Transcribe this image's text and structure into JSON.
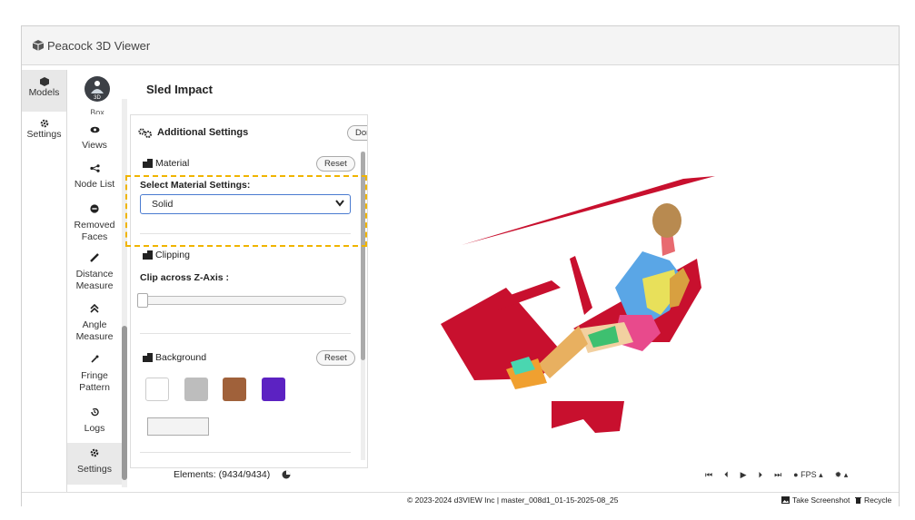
{
  "app": {
    "title": "Peacock 3D Viewer"
  },
  "left_nav": [
    {
      "label": "Models",
      "icon": "cube-icon"
    },
    {
      "label": "Settings",
      "icon": "gear-icon"
    }
  ],
  "tools": {
    "top_cut": "Box",
    "badge": "3D",
    "items": [
      {
        "label": "Views",
        "icon": "eye-icon"
      },
      {
        "label": "Node List",
        "icon": "share-nodes-icon"
      },
      {
        "label": "Removed\nFaces",
        "icon": "minus-circle-icon"
      },
      {
        "label": "Distance\nMeasure",
        "icon": "ruler-icon"
      },
      {
        "label": "Angle\nMeasure",
        "icon": "angle-icon"
      },
      {
        "label": "Fringe\nPattern",
        "icon": "eyedropper-icon"
      },
      {
        "label": "Logs",
        "icon": "history-icon"
      },
      {
        "label": "Settings",
        "icon": "gear-icon"
      }
    ]
  },
  "viewer": {
    "title": "Sled Impact"
  },
  "panel": {
    "title": "Additional Settings",
    "done_label": "Done",
    "material": {
      "label": "Material",
      "reset_label": "Reset",
      "select_label": "Select Material Settings:",
      "select_value": "Solid"
    },
    "clipping": {
      "label": "Clipping",
      "slider_label": "Clip across Z-Axis :",
      "slider_value": 0
    },
    "background": {
      "label": "Background",
      "reset_label": "Reset",
      "swatches": [
        "#ffffff",
        "#bdbdbd",
        "#a0613a",
        "#5c22c2"
      ]
    }
  },
  "status": {
    "elements": "Elements: (9434/9434)",
    "fps_label": "FPS"
  },
  "footer": {
    "copyright": "© 2023-2024 d3VIEW Inc | master_008d1_01-15-2025-08_25",
    "screenshot_label": "Take Screenshot",
    "recycle_label": "Recycle"
  },
  "colors": {
    "accent_dashed": "#f0b400",
    "model_red": "#c8102e",
    "select_border": "#4a7bd0"
  }
}
